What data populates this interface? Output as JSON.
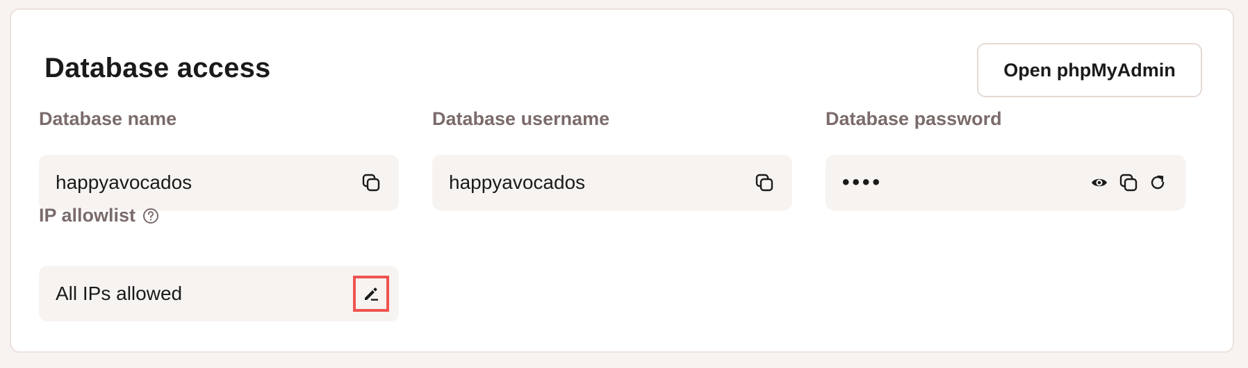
{
  "section": {
    "title": "Database access",
    "open_button_label": "Open phpMyAdmin"
  },
  "fields": {
    "name": {
      "label": "Database name",
      "value": "happyavocados",
      "icon": "copy-icon"
    },
    "username": {
      "label": "Database username",
      "value": "happyavocados",
      "icon": "copy-icon"
    },
    "password": {
      "label": "Database password",
      "value": "••••",
      "icons": [
        "eye-icon",
        "copy-icon",
        "refresh-icon"
      ]
    },
    "ip_allowlist": {
      "label": "IP allowlist",
      "value": "All IPs allowed",
      "label_icon": "help-icon",
      "icon": "edit-icon"
    }
  },
  "colors": {
    "label": "#7b6b6b",
    "field_background": "#f7f3f0",
    "highlight": "#ef5350"
  }
}
